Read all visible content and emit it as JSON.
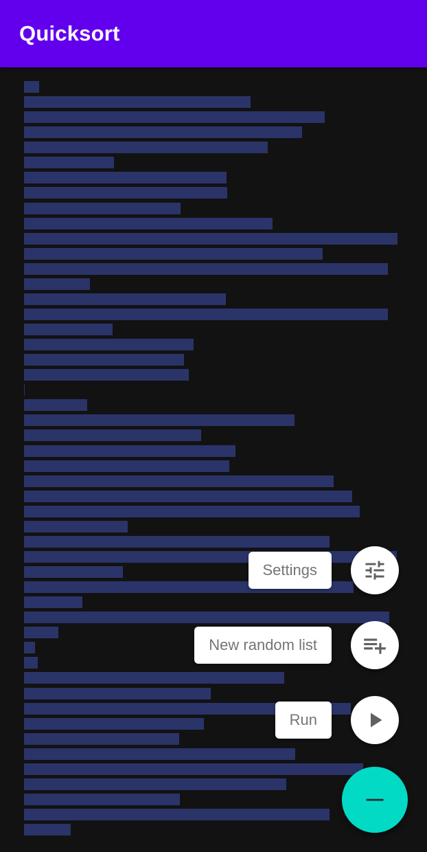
{
  "app_bar": {
    "title": "Quicksort",
    "color": "#6200EE"
  },
  "list_bars": {
    "color": "#2B3468",
    "max_value": 1.0,
    "values": [
      0.04,
      0.607,
      0.806,
      0.744,
      0.652,
      0.241,
      0.542,
      0.544,
      0.419,
      0.665,
      1.0,
      0.8,
      0.975,
      0.176,
      0.541,
      0.975,
      0.238,
      0.454,
      0.428,
      0.441,
      0.002,
      0.169,
      0.724,
      0.474,
      0.566,
      0.55,
      0.829,
      0.879,
      0.898,
      0.278,
      0.818,
      0.998,
      0.265,
      0.882,
      0.157,
      0.978,
      0.091,
      0.03,
      0.037,
      0.696,
      0.5,
      0.875,
      0.482,
      0.415,
      0.726,
      0.908,
      0.703,
      0.418,
      0.818,
      0.125
    ]
  },
  "speed_dial": {
    "actions": [
      {
        "label": "Settings",
        "icon": "tune-icon"
      },
      {
        "label": "New random list",
        "icon": "playlist-add-icon"
      },
      {
        "label": "Run",
        "icon": "play-icon"
      }
    ],
    "main_button": {
      "icon": "minus-icon",
      "color": "#03DAC5"
    }
  }
}
